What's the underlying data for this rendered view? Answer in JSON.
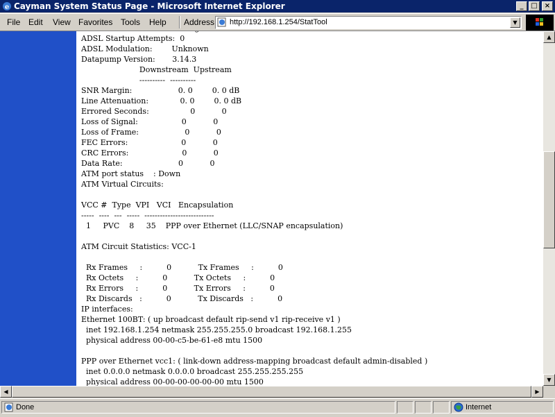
{
  "window": {
    "title": "Cayman System Status Page - Microsoft Internet Explorer"
  },
  "menu": [
    "File",
    "Edit",
    "View",
    "Favorites",
    "Tools",
    "Help"
  ],
  "address": {
    "label": "Address",
    "url": "http://192.168.1.254/StatTool"
  },
  "page_text": "ADSL Line State:     Activating\nADSL Startup Attempts:  0\nADSL Modulation:        Unknown\nDatapump Version:       3.14.3\n                        Downstream  Upstream\n                        ----------  ----------\nSNR Margin:                   0. 0        0. 0 dB\nLine Attenuation:             0. 0        0. 0 dB\nErrored Seconds:                 0           0\nLoss of Signal:                  0           0\nLoss of Frame:                   0           0\nFEC Errors:                      0           0\nCRC Errors:                      0           0\nData Rate:                       0           0\nATM port status    : Down\nATM Virtual Circuits:\n\nVCC #  Type  VPI   VCI   Encapsulation\n-----  ----  ---  -----  ---------------------------\n  1     PVC    8     35    PPP over Ethernet (LLC/SNAP encapsulation)\n\nATM Circuit Statistics: VCC-1\n\n  Rx Frames     :          0           Tx Frames     :          0\n  Rx Octets     :          0           Tx Octets     :          0\n  Rx Errors     :          0           Tx Errors     :          0\n  Rx Discards   :          0           Tx Discards   :          0\nIP interfaces:\nEthernet 100BT: ( up broadcast default rip-send v1 rip-receive v1 )\n  inet 192.168.1.254 netmask 255.255.255.0 broadcast 192.168.1.255\n  physical address 00-00-c5-be-61-e8 mtu 1500\n\nPPP over Ethernet vcc1: ( link-down address-mapping broadcast default admin-disabled )\n  inet 0.0.0.0 netmask 0.0.0.0 broadcast 255.255.255.255\n  physical address 00-00-00-00-00-00 mtu 1500",
  "status": {
    "text": "Done",
    "zone": "Internet"
  }
}
